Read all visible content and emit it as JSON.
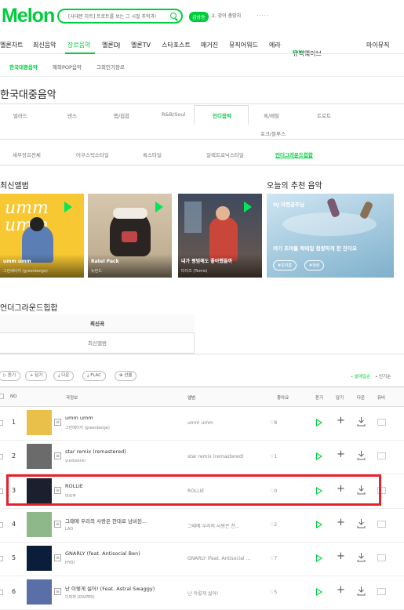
{
  "header": {
    "logo": "Melon",
    "search_placeholder": "[사대문 차트] 트로트를 보는 그 시절 추억과!",
    "badge": "급상승",
    "hot_keyword": "2. 강이 충망치",
    "dots": "·····"
  },
  "gnb": {
    "items": [
      "멜론차트",
      "최신음악",
      "장르음악",
      "멜론DJ",
      "멜론TV",
      "스타포스트",
      "매거진",
      "뮤직어워드",
      "에라",
      "뮤직웨이브"
    ],
    "beta": "beta",
    "my": "마이뮤직"
  },
  "subnav": [
    "한국대중음악",
    "해외POP음악",
    "그외인기장르"
  ],
  "page_title": "한국대중음악",
  "genre_tabs_row1": [
    "발라드",
    "댄스",
    "랩/힙합",
    "R&B/Soul",
    "인디음악",
    "록/메탈",
    "트로트"
  ],
  "genre_tabs_row1b": "포크/블루스",
  "genre_tabs_row2": [
    "세부장르전체",
    "어쿠스틱스타일",
    "록스타일",
    "일렉트로닉스타일",
    "언더그라운드힙합"
  ],
  "latest_album": {
    "title": "최신앨범",
    "items": [
      {
        "title": "umm umm",
        "artist": "그린베이지 (greenbeige)",
        "art_text": "umm umm"
      },
      {
        "title": "Ratel Pack",
        "artist": "뉴펀드"
      },
      {
        "title": "내가 평범해도 좋아했을까",
        "artist": "타이즈 (Tomis)"
      }
    ]
  },
  "recommend": {
    "title": "오늘의 추천 음악",
    "dj": "DJ 마멘공주님",
    "text": "여기 초여름 락테일 청량하게 한 잔이요",
    "tags": [
      "#초여름",
      "#청량"
    ]
  },
  "section_title": "언더그라운드힙합",
  "list_tabs": [
    "최신곡",
    "최신앨범"
  ],
  "action_buttons": [
    "듣기",
    "담기",
    "다운",
    "FLAC",
    "선물"
  ],
  "sort": [
    "발매일순",
    "인기순"
  ],
  "columns": [
    "NO",
    "곡정보",
    "앨범",
    "좋아요",
    "듣기",
    "담기",
    "다운",
    "뮤비"
  ],
  "songs": [
    {
      "no": "1",
      "title": "umm umm",
      "artist": "그린베이지 (greenbeige)",
      "album": "umm umm",
      "likes": "8",
      "thumb": "#e8c04a"
    },
    {
      "no": "2",
      "title": "star remix (remastered)",
      "artist": "yunbeenin",
      "album": "star remix (remastered)",
      "likes": "1",
      "thumb": "#6b6b6b"
    },
    {
      "no": "3",
      "title": "ROLLIE",
      "artist": "마르주",
      "album": "ROLLIE",
      "likes": "0",
      "thumb": "#1c1f2e"
    },
    {
      "no": "4",
      "title": "그때에 우리의 사랑은 찬대로 남비된...",
      "artist": "LAD",
      "album": "그때에 우리의 사랑은 찬...",
      "likes": "2",
      "thumb": "#8fb88a"
    },
    {
      "no": "5",
      "title": "GNARLY (feat. Antisocial Ben)",
      "artist": "HYOI",
      "album": "GNARLY (feat. Antisocial ...",
      "likes": "7",
      "thumb": "#0a1e3c"
    },
    {
      "no": "6",
      "title": "난 이렇게 싫어! (Feat. Astral Swaggy)",
      "artist": "디퍼퍼 (DIVPER)",
      "album": "난 이렇게 싫어!",
      "likes": "5",
      "thumb": "#5a6ea8"
    }
  ],
  "colors": {
    "accent": "#00cd3c",
    "highlight": "#e8202a"
  }
}
